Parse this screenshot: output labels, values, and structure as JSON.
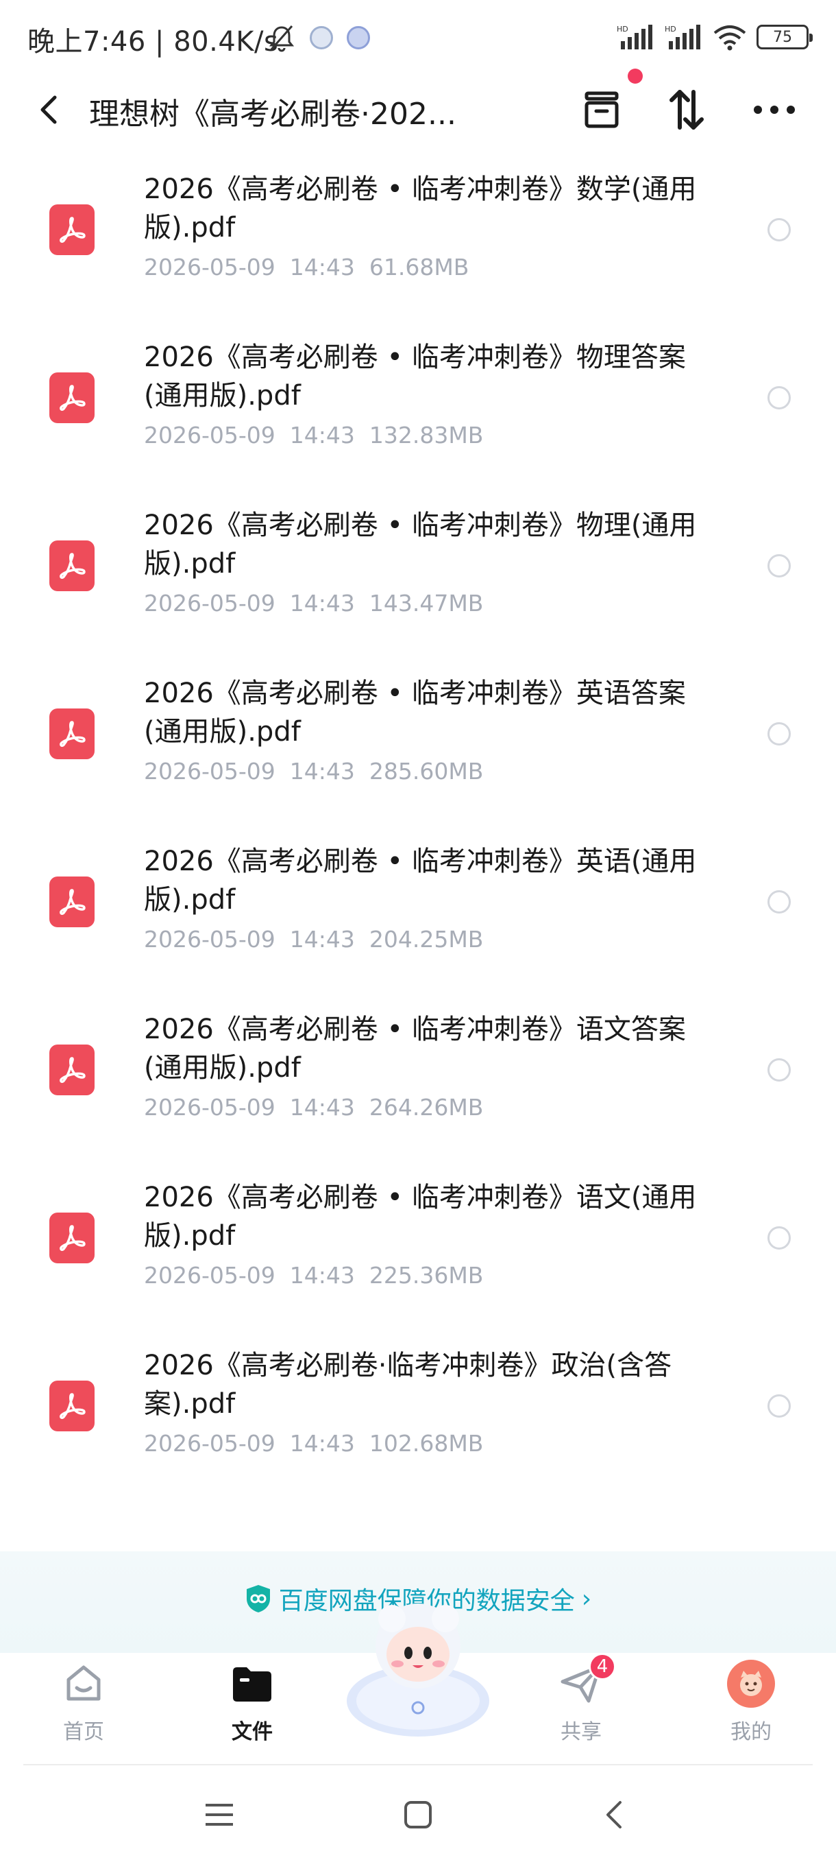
{
  "status_bar": {
    "time": "晚上7:46 | 80.4K/s",
    "battery": "75"
  },
  "header": {
    "title": "理想树《高考必刷卷·202..."
  },
  "files": [
    {
      "name": "2026《高考必刷卷 • 临考冲刺卷》数学(通用版).pdf",
      "date": "2026-05-09",
      "time": "14:43",
      "size": "61.68MB"
    },
    {
      "name": "2026《高考必刷卷 • 临考冲刺卷》物理答案(通用版).pdf",
      "date": "2026-05-09",
      "time": "14:43",
      "size": "132.83MB"
    },
    {
      "name": "2026《高考必刷卷 • 临考冲刺卷》物理(通用版).pdf",
      "date": "2026-05-09",
      "time": "14:43",
      "size": "143.47MB"
    },
    {
      "name": "2026《高考必刷卷 • 临考冲刺卷》英语答案(通用版).pdf",
      "date": "2026-05-09",
      "time": "14:43",
      "size": "285.60MB"
    },
    {
      "name": "2026《高考必刷卷 • 临考冲刺卷》英语(通用版).pdf",
      "date": "2026-05-09",
      "time": "14:43",
      "size": "204.25MB"
    },
    {
      "name": "2026《高考必刷卷 • 临考冲刺卷》语文答案(通用版).pdf",
      "date": "2026-05-09",
      "time": "14:43",
      "size": "264.26MB"
    },
    {
      "name": "2026《高考必刷卷 • 临考冲刺卷》语文(通用版).pdf",
      "date": "2026-05-09",
      "time": "14:43",
      "size": "225.36MB"
    },
    {
      "name": "2026《高考必刷卷·临考冲刺卷》政治(含答案).pdf",
      "date": "2026-05-09",
      "time": "14:43",
      "size": "102.68MB"
    }
  ],
  "security_banner": {
    "text": "百度网盘保障你的数据安全"
  },
  "tabs": [
    {
      "label": "首页",
      "icon": "home-icon"
    },
    {
      "label": "文件",
      "icon": "folder-icon"
    },
    {
      "label": "共享",
      "icon": "share-plane-icon",
      "badge": "4"
    },
    {
      "label": "我的",
      "icon": "avatar-icon"
    }
  ],
  "colors": {
    "accent": "#12a4be",
    "pdf_red": "#ee4c5a",
    "badge_red": "#f23b5f",
    "meta_gray": "#a7acb6"
  }
}
